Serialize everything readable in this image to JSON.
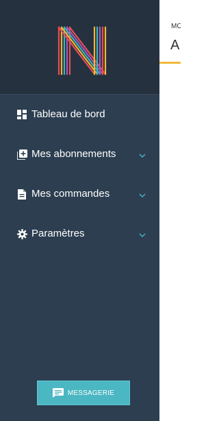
{
  "brand": {
    "logo_letter": "N"
  },
  "sidebar": {
    "items": [
      {
        "label": "Tableau de bord",
        "icon": "dashboard-icon",
        "has_submenu": false
      },
      {
        "label": "Mes abonnements",
        "icon": "add-box-icon",
        "has_submenu": true
      },
      {
        "label": "Mes commandes",
        "icon": "document-icon",
        "has_submenu": true
      },
      {
        "label": "Paramètres",
        "icon": "gear-icon",
        "has_submenu": true
      }
    ],
    "messaging_button": {
      "label": "MESSAGERIE",
      "icon": "chat-icon"
    }
  },
  "main": {
    "breadcrumb": "MO",
    "title": "A"
  },
  "colors": {
    "sidebar_bg": "#2c3e50",
    "sidebar_head_bg": "#25313e",
    "accent": "#4bb7c2",
    "chevron": "#3fa9b4",
    "title_underline": "#f0b93a"
  }
}
